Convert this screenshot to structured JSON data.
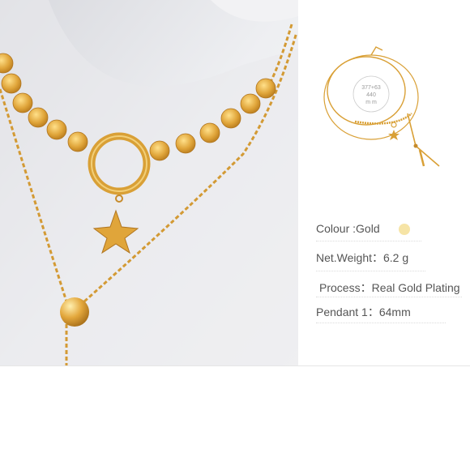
{
  "product_photo": {
    "subject": "gold layered necklace with coin chain, ring and star pendant, and bead drop"
  },
  "thumbnail": {
    "dimensions_text_1": "377+63",
    "dimensions_text_2": "440",
    "dimensions_text_3": "m m"
  },
  "specs": {
    "colour_label": "Colour :",
    "colour_value": "Gold",
    "colour_swatch": "#f6e4a6",
    "weight_label": "Net.Weight：",
    "weight_value": "6.2 g",
    "process_label": "Process：",
    "process_value": "Real Gold Plating",
    "pendant_label": "Pendant 1：",
    "pendant_value": "64mm"
  },
  "colors": {
    "gold": "#d9a036",
    "text": "#555555"
  }
}
